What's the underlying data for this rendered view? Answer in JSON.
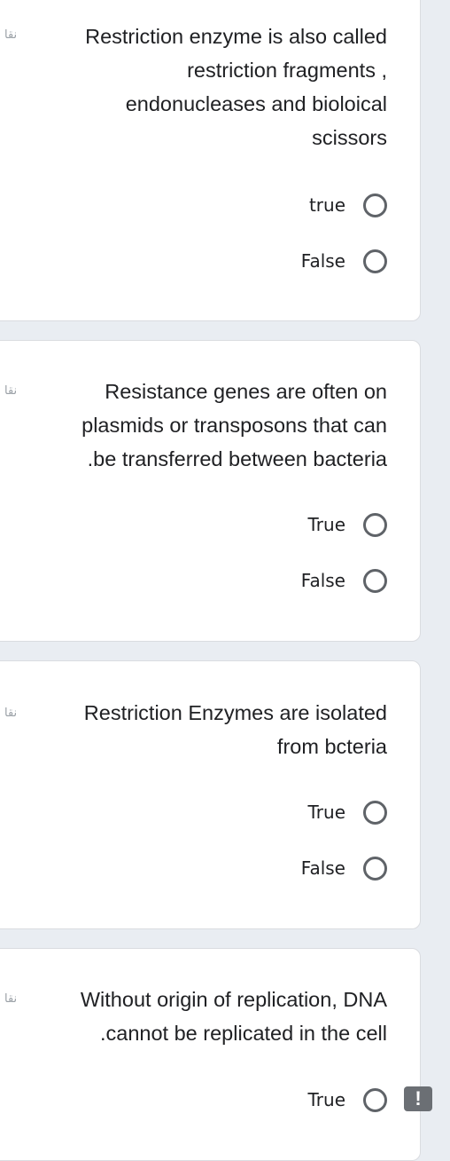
{
  "questions": [
    {
      "points_label": "نقا",
      "text": "Restriction enzyme is also called\nrestriction fragments ,\nendonucleases and bioloical\nscissors",
      "options": [
        "true",
        "False"
      ]
    },
    {
      "points_label": "نقا",
      "text": "Resistance genes are often on\nplasmids or transposons that can\n.be transferred between bacteria",
      "options": [
        "True",
        "False"
      ]
    },
    {
      "points_label": "نقا",
      "text": "Restriction Enzymes are isolated\nfrom bcteria",
      "options": [
        "True",
        "False"
      ]
    },
    {
      "points_label": "نقا",
      "text": "Without origin of replication, DNA\n.cannot be replicated in the cell",
      "options": [
        "True"
      ]
    }
  ],
  "feedback_icon": {
    "icon": "report-issue-icon",
    "glyph": "!"
  },
  "colors": {
    "background": "#e9edf2",
    "card": "#ffffff",
    "radio_border": "#5f6368",
    "text": "#202124"
  }
}
